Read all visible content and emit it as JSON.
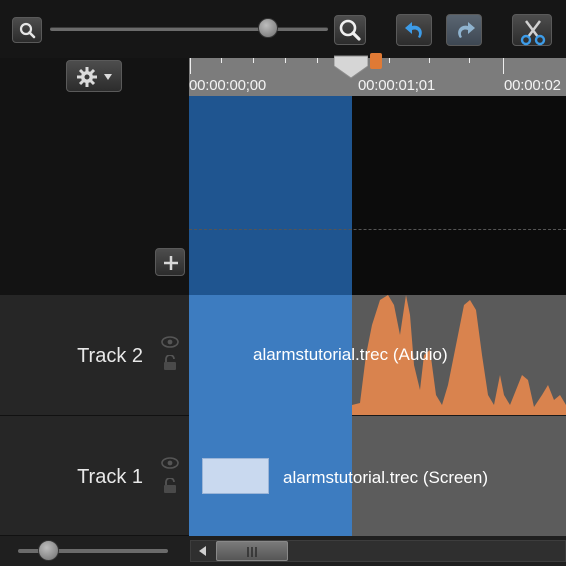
{
  "toolbar": {
    "zoom_out_icon": "magnifier-small-icon",
    "zoom_in_icon": "magnifier-large-icon",
    "undo_icon": "undo-icon",
    "redo_icon": "redo-icon",
    "cut_icon": "scissors-icon",
    "zoom_level": 0.84
  },
  "timeline": {
    "settings_icon": "gear-icon",
    "add_track_icon": "plus-icon",
    "ruler_labels": [
      "00:00:00;00",
      "00:00:01;01",
      "00:00:02"
    ],
    "accent_selection": "#2e78be",
    "accent_audio": "#e07a35"
  },
  "tracks": [
    {
      "name": "Track 2",
      "clip_label": "alarmstutorial.trec (Audio)"
    },
    {
      "name": "Track 1",
      "clip_label": "alarmstutorial.trec (Screen)"
    }
  ],
  "bottom": {
    "scroll_left_icon": "arrow-left-icon",
    "zoom_level": 0.2
  }
}
